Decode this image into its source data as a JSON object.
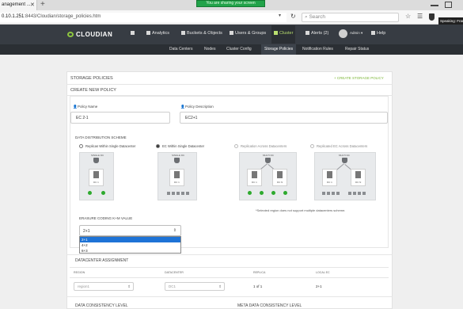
{
  "browser": {
    "tab_title": "anagement ...",
    "tab_close": "✕",
    "new_tab": "+",
    "url_prefix": "0.10.1.251",
    "url_rest": ":8443/Cloudian/storage_policies.htm",
    "search_placeholder": "Search",
    "sharing_banner": "You are sharing your screen",
    "speaking_label": "Speaking: Frank"
  },
  "app": {
    "logo": "CLOUDIAN",
    "nav": [
      "Analytics",
      "Buckets & Objects",
      "Users & Groups",
      "Cluster",
      "Alerts (2)",
      "Admin ▾",
      "Help"
    ],
    "subnav": [
      "Data Centers",
      "Nodes",
      "Cluster Config",
      "Storage Policies",
      "Notification Rules",
      "Repair Status"
    ]
  },
  "page": {
    "section_title": "STORAGE POLICIES",
    "create_link": "+ CREATE STORAGE POLICY",
    "create_title": "CREATE NEW POLICY",
    "policy_name_label": "Policy Name",
    "policy_name_value": "EC 2-1",
    "policy_desc_label": "Policy Description",
    "policy_desc_value": "EC2+1",
    "distribution_title": "DATA DISTRIBUTION SCHEME",
    "schemes": [
      {
        "label": "Replicas Within Single Datacenter",
        "selected": false
      },
      {
        "label": "EC Within Single Datacenter",
        "selected": true
      },
      {
        "label": "Replication Across Datacenters",
        "selected": false
      },
      {
        "label": "Replicated EC Across Datacenters",
        "selected": false
      }
    ],
    "diagram_heads": [
      "SINGLE DC",
      "SINGLE DC",
      "MULTI DC",
      "MULTI DC"
    ],
    "diagram_dc_labels": [
      "DC 1",
      "DC 1",
      "DC 1",
      "DC N",
      "DC 1",
      "DC N"
    ],
    "note": "*Selected region does not support multiple datacenters scheme.",
    "erasure_label": "ERASURE CODING K+M VALUE",
    "erasure_value": "2+1",
    "erasure_options": [
      "2+1",
      "4+2",
      "6+3"
    ],
    "dc_assignment_title": "DATACENTER ASSIGNMENT",
    "dc_table_headers": [
      "REGION",
      "DATACENTER",
      "REPLICA",
      "LOCAL EC"
    ],
    "dc_row": {
      "region": "region1",
      "datacenter": "DC1",
      "replica": "1 of 1",
      "local_ec": "2+1"
    },
    "consistency_label": "DATA CONSISTENCY LEVEL",
    "meta_consistency_label": "META DATA CONSISTENCY LEVEL"
  },
  "colors": {
    "header_bg": "#373c43",
    "accent_green": "#8dc63f",
    "share_green": "#22a34a",
    "dot_green": "#2eaa2e"
  }
}
